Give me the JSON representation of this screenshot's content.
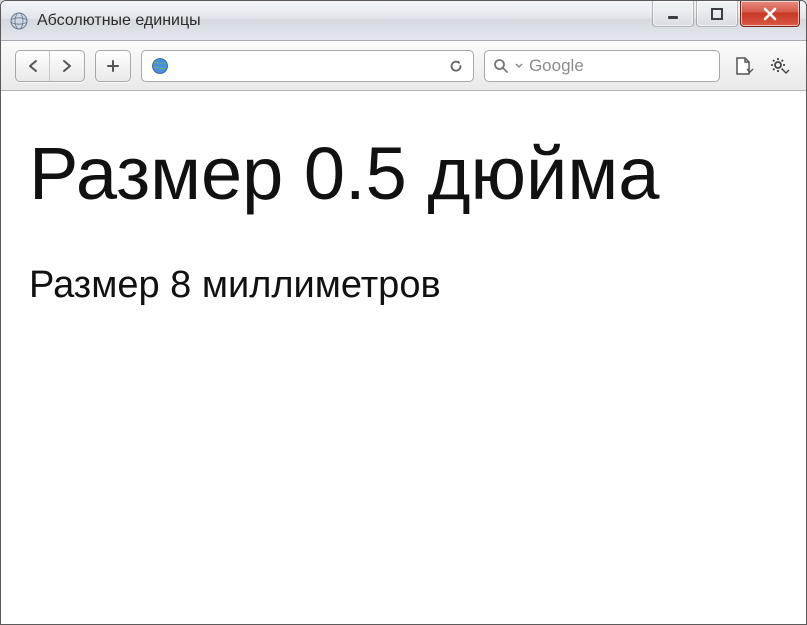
{
  "window": {
    "title": "Абсолютные единицы"
  },
  "toolbar": {
    "search_placeholder": "Google"
  },
  "content": {
    "line1": "Размер 0.5 дюйма",
    "line2": "Размер 8 миллиметров"
  }
}
